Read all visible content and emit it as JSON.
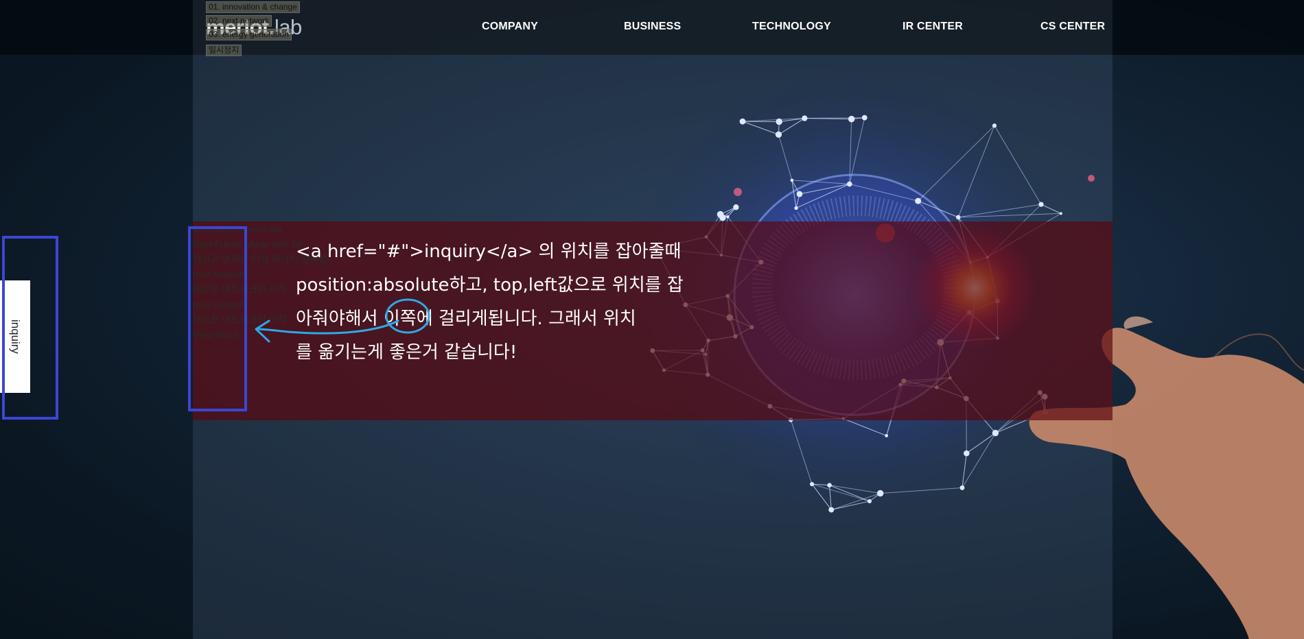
{
  "header": {
    "logo": {
      "main": "merlot",
      "dot": ".",
      "suffix": "lab"
    },
    "nav": [
      "COMPANY",
      "BUSINESS",
      "TECHNOLOGY",
      "IR CENTER",
      "CS CENTER"
    ]
  },
  "slider_controls": [
    "01. innovation & change",
    "02. next network",
    "03. energy generation",
    "일시정지"
  ],
  "slide_text": [
    "Innovation merlot.lab",
    "New Future Made with lot",
    "혁신과 변화의 미래 에너지 멀롯랩",
    "next network",
    "새로운 네트워크의 시작",
    "next network",
    "새로운 네트워크의 시작",
    "View More"
  ],
  "inquiry": {
    "label": "inquiry"
  },
  "annotation": {
    "lines": [
      "<a href=\"#\">inquiry</a> 의 위치를 잡아줄때",
      "position:absolute하고, top,left값으로 위치를 잡",
      "아줘야해서 이쪽에 걸리게됩니다. 그래서 위치",
      "를 옮기는게 좋은거 같습니다!"
    ]
  },
  "colors": {
    "annotation_box": "#3c46d4",
    "annotation_arrow": "#2fa8e8",
    "banner": "#5a060e",
    "header_bg": "#040a10"
  }
}
